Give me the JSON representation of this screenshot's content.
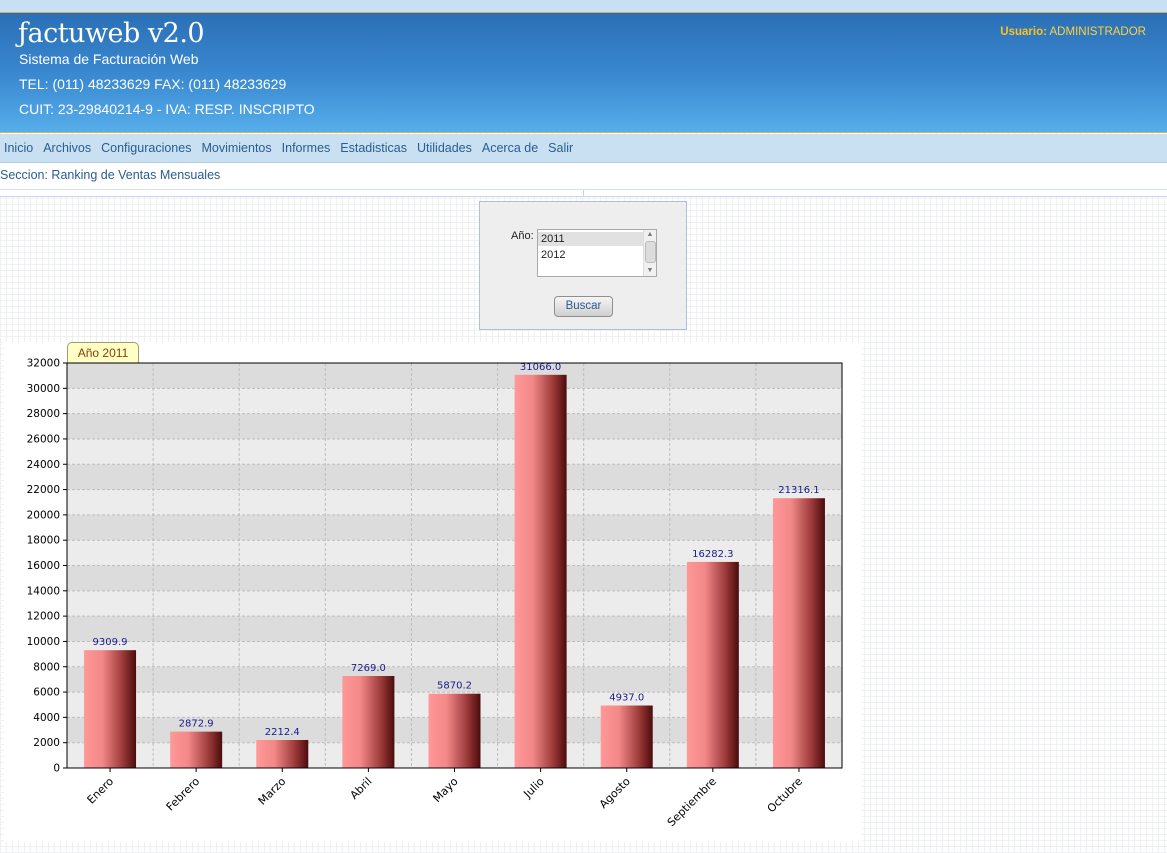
{
  "header": {
    "logo": "ƒactuweb v2.0",
    "subtitle": "Sistema de Facturación Web",
    "phone": "TEL: (011) 48233629 FAX: (011) 48233629",
    "cuit": "CUIT: 23-29840214-9 - IVA: RESP. INSCRIPTO",
    "user_label": "Usuario:",
    "user_name": "ADMINISTRADOR"
  },
  "nav": {
    "items": [
      "Inicio",
      "Archivos",
      "Configuraciones",
      "Movimientos",
      "Informes",
      "Estadisticas",
      "Utilidades",
      "Acerca de",
      "Salir"
    ]
  },
  "section": {
    "text": "Seccion: Ranking de Ventas Mensuales"
  },
  "form": {
    "year_label": "Año:",
    "year_options": [
      "2011",
      "2012"
    ],
    "selected": "2011",
    "button": "Buscar"
  },
  "chart_tab": "Año 2011",
  "chart_data": {
    "type": "bar",
    "categories": [
      "Enero",
      "Febrero",
      "Marzo",
      "Abril",
      "Mayo",
      "Julio",
      "Agosto",
      "Septiembre",
      "Octubre"
    ],
    "values": [
      9309.9,
      2872.9,
      2212.4,
      7269.0,
      5870.2,
      31066.0,
      4937.0,
      16282.3,
      21316.1
    ],
    "value_labels": [
      "9309.9",
      "2872.9",
      "2212.4",
      "7269.0",
      "5870.2",
      "31066.0",
      "4937.0",
      "16282.3",
      "21316.1"
    ],
    "yticks": [
      0,
      2000,
      4000,
      6000,
      8000,
      10000,
      12000,
      14000,
      16000,
      18000,
      20000,
      22000,
      24000,
      26000,
      28000,
      30000,
      32000
    ],
    "ylim": [
      0,
      32000
    ],
    "grid": true,
    "colors": {
      "bar_light": "#ff9898",
      "bar_dark": "#5a1010",
      "label": "#1a1a8c",
      "band": "#e3e3e3"
    }
  }
}
